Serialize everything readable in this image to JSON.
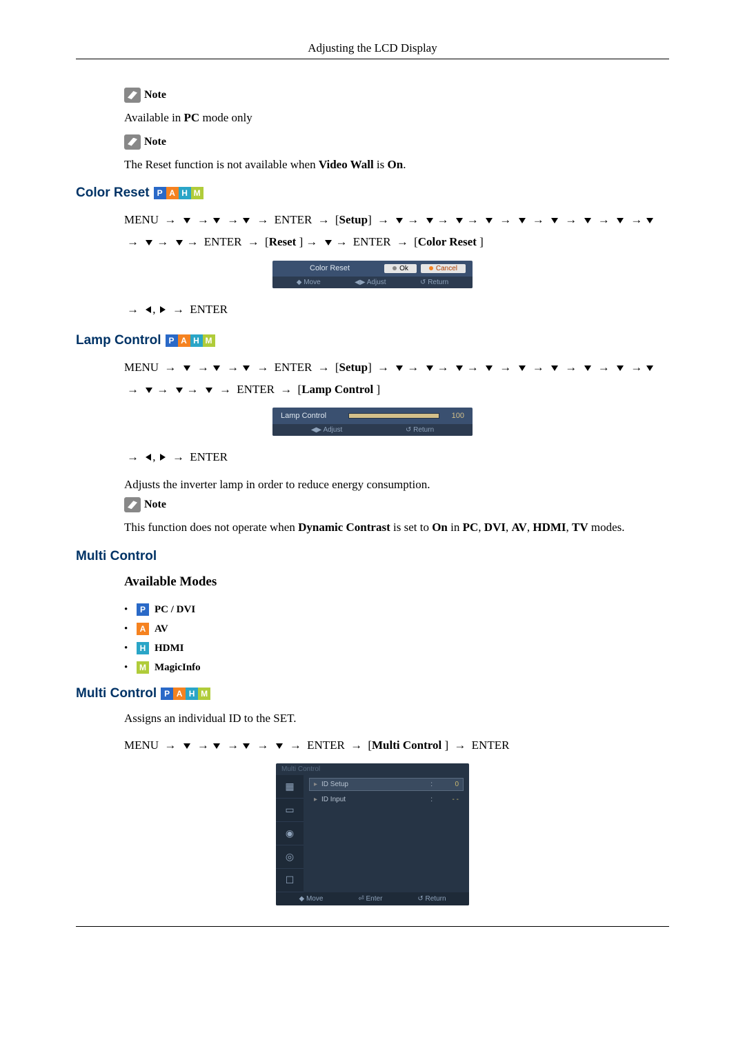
{
  "header": "Adjusting the LCD Display",
  "note_label": "Note",
  "note1_text_pre": "Available in ",
  "note1_text_bold": "PC",
  "note1_text_post": " mode only",
  "note2_pre": "The Reset function is not available when ",
  "note2_bold": "Video Wall",
  "note2_mid": " is ",
  "note2_bold2": "On",
  "note2_post": ".",
  "sections": {
    "color_reset": {
      "title": "Color Reset",
      "nav_menu": "MENU",
      "nav_enter": "ENTER",
      "nav_setup_label": "Setup",
      "nav_reset_label": "Reset ",
      "nav_colorreset_label": "Color Reset ",
      "osd": {
        "title": "Color Reset",
        "ok": "Ok",
        "cancel": "Cancel",
        "footer_move": "Move",
        "footer_adjust": "Adjust",
        "footer_return": "Return"
      }
    },
    "lamp": {
      "title": "Lamp Control",
      "nav_menu": "MENU",
      "nav_enter": "ENTER",
      "nav_setup_label": "Setup",
      "nav_lamp_label": "Lamp Control ",
      "osd": {
        "label": "Lamp Control",
        "value": "100",
        "footer_adjust": "Adjust",
        "footer_return": "Return"
      },
      "desc": "Adjusts the inverter lamp in order to reduce energy consumption.",
      "note_pre": "This function does not operate when ",
      "note_b1": "Dynamic Contrast",
      "note_mid1": " is set to ",
      "note_b2": "On",
      "note_mid2": " in ",
      "note_b3": "PC",
      "note_c1": ", ",
      "note_b4": "DVI",
      "note_c2": ", ",
      "note_b5": "AV",
      "note_c3": ", ",
      "note_b6": "HDMI",
      "note_c4": ", ",
      "note_b7": "TV",
      "note_post": " modes."
    },
    "multi": {
      "title": "Multi Control",
      "available": "Available Modes",
      "mode_pc": "PC / DVI",
      "mode_av": "AV",
      "mode_hdmi": "HDMI",
      "mode_magic": "MagicInfo",
      "title2": "Multi Control",
      "desc": "Assigns an individual ID to the SET.",
      "nav_menu": "MENU",
      "nav_enter": "ENTER",
      "nav_mc_label": "Multi Control ",
      "osd": {
        "titlebar": "Multi Control",
        "item1": "ID  Setup",
        "val1": "0",
        "item2": "ID  Input",
        "val2": "- -",
        "footer_move": "Move",
        "footer_enter": "Enter",
        "footer_return": "Return"
      }
    }
  },
  "badges": {
    "p": "P",
    "a": "A",
    "h": "H",
    "m": "M"
  }
}
